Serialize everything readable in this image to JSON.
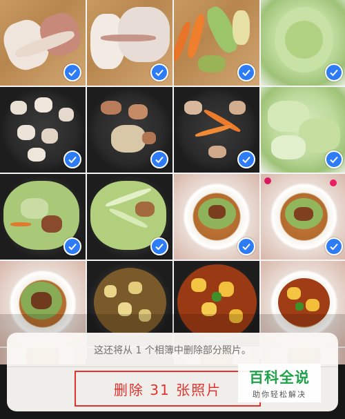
{
  "sheet": {
    "message": "这还将从 1 个相簿中删除部分照片。",
    "delete_label": "删除 31 张照片"
  },
  "watermark": {
    "title": "百科全说",
    "subtitle": "助你轻松解决"
  },
  "colors": {
    "accent": "#2d7cf6",
    "destructive": "#e2322b",
    "watermark_green": "#1fa24a"
  },
  "photos": [
    {
      "subject": "pork-belly-on-board",
      "selected": true
    },
    {
      "subject": "sliced-pork-on-board",
      "selected": true
    },
    {
      "subject": "carrot-scallion-chili-prep",
      "selected": true
    },
    {
      "subject": "cabbage-head",
      "selected": true
    },
    {
      "subject": "pork-cubes-in-wok",
      "selected": true
    },
    {
      "subject": "pork-with-ginger-in-wok",
      "selected": true
    },
    {
      "subject": "pork-with-carrot-in-wok",
      "selected": true
    },
    {
      "subject": "torn-cabbage-leaves",
      "selected": true
    },
    {
      "subject": "cabbage-stirfry-in-wok",
      "selected": true
    },
    {
      "subject": "cabbage-scallion-stirfry",
      "selected": true
    },
    {
      "subject": "plated-stirfry",
      "selected": true
    },
    {
      "subject": "plated-stirfry-with-flowers",
      "selected": true
    },
    {
      "subject": "plated-stirfry-partial",
      "selected": false
    },
    {
      "subject": "potato-stew-in-wok",
      "selected": false
    },
    {
      "subject": "potato-stew-plate",
      "selected": false
    },
    {
      "subject": "potato-stew-plate-2",
      "selected": false
    }
  ]
}
